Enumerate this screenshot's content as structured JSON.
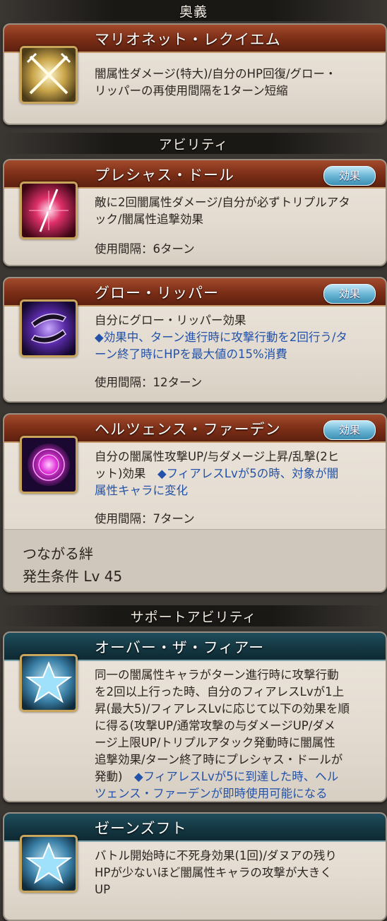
{
  "sections": {
    "ougi": "奥義",
    "ability": "アビリティ",
    "support": "サポートアビリティ"
  },
  "ougi": {
    "name": "マリオネット・レクイエム",
    "desc_line1": "闇属性ダメージ(特大)/自分のHP回復/グロー・",
    "desc_line2": "リッパーの再使用間隔を1ターン短縮"
  },
  "abilities": [
    {
      "name": "プレシャス・ドール",
      "effect_button": "効果",
      "desc_line1": "敵に2回闇属性ダメージ/自分が必ずトリプルアタ",
      "desc_line2": "ック/闇属性追撃効果",
      "interval": "使用間隔：6ターン"
    },
    {
      "name": "グロー・リッパー",
      "effect_button": "効果",
      "desc_line1": "自分にグロー・リッパー効果",
      "desc_line2": "◆効果中、ターン進行時に攻撃行動を2回行う/タ",
      "desc_line3": "ーン終了時にHPを最大値の15%消費",
      "interval": "使用間隔：12ターン"
    },
    {
      "name": "ヘルツェンス・ファーデン",
      "effect_button": "効果",
      "desc_line1": "自分の闇属性攻撃UP/与ダメージ上昇/乱撃(2ヒ",
      "desc_line2a": "ット)効果　",
      "desc_line2b": "◆フィアレスLvが5の時、対象が闇",
      "desc_line3": "属性キャラに変化",
      "interval": "使用間隔：7ターン",
      "bond_title": "つながる絆",
      "bond_condition": "発生条件 Lv 45"
    }
  ],
  "supports": [
    {
      "name": "オーバー・ザ・フィアー",
      "lines": [
        "同一の闇属性キャラがターン進行時に攻撃行動",
        "を2回以上行った時、自分のフィアレスLvが1上",
        "昇(最大5)/フィアレスLvに応じて以下の効果を順",
        "に得る(攻撃UP/通常攻撃の与ダメージUP/ダメ",
        "ージ上限UP/トリプルアタック発動時に闇属性",
        "追撃効果/ターン終了時にプレシャス・ドールが"
      ],
      "line7a": "発動)　",
      "line7b": "◆フィアレスLvが5に到達した時、ヘル",
      "line8": "ツェンス・ファーデンが即時使用可能になる"
    },
    {
      "name": "ゼーンズフト",
      "lines": [
        "バトル開始時に不死身効果(1回)/ダヌアの残り",
        "HPが少ないほど闇属性キャラの攻撃が大きく",
        "UP"
      ]
    }
  ],
  "colors": {
    "ougi_bar": "#7a2d16",
    "support_bar": "#143742",
    "highlight_text": "#2352a8",
    "effect_button": "#6cb7d6"
  },
  "icons": [
    "crossed-swords-icon",
    "pink-slash-icon",
    "dual-blades-icon",
    "magenta-orb-icon",
    "star-icon",
    "star-icon"
  ]
}
